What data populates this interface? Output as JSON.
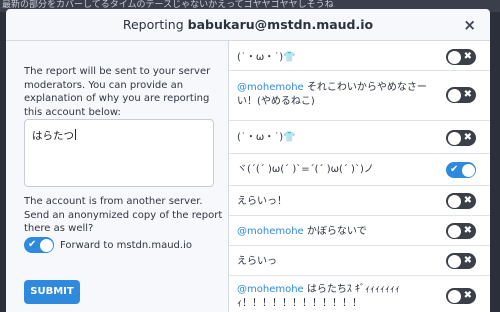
{
  "background_text": "最新の部分をカバーしてるタイムのテースじゃないかえってゴヤヤゴヤヤしそうね",
  "modal": {
    "title_prefix": "Reporting",
    "title_account": "babukaru@mstdn.maud.io",
    "close_glyph": "×"
  },
  "form": {
    "intro": "The report will be sent to your server moderators. You can provide an explanation of why you are reporting this account below:",
    "comment_value": "はらたつ",
    "anon_text": "The account is from another server. Send an anonymized copy of the report there as well?",
    "forward_label": "Forward to mstdn.maud.io",
    "forward_on": true,
    "submit_label": "SUBMIT"
  },
  "statuses": [
    {
      "mention": "",
      "text": "(˙・ω・˙)👕",
      "selected": false
    },
    {
      "mention": "@mohemohe",
      "text": " それこわいからやめなさーい！(やめるねこ)",
      "selected": false
    },
    {
      "mention": "",
      "text": "(˙・ω・˙)👕",
      "selected": false
    },
    {
      "mention": "",
      "text": "ヾ(ˊ(ˊ )ω(ˊ )ˋ=ˊ(ˊ )ω(ˊ )ˋ)ノ",
      "selected": true
    },
    {
      "mention": "",
      "text": "えらいっ！",
      "selected": false
    },
    {
      "mention": "@mohemohe",
      "text": " かぼらないで",
      "selected": false
    },
    {
      "mention": "",
      "text": "えらいっ",
      "selected": false
    },
    {
      "mention": "@mohemohe",
      "text": " はらたちｽ ｷﾞｨｨｨｨｨｨｨｨ！！！！！！！！！！！！",
      "selected": false
    }
  ],
  "colors": {
    "accent": "#2f8ade",
    "toggle_off": "#3b4048"
  }
}
